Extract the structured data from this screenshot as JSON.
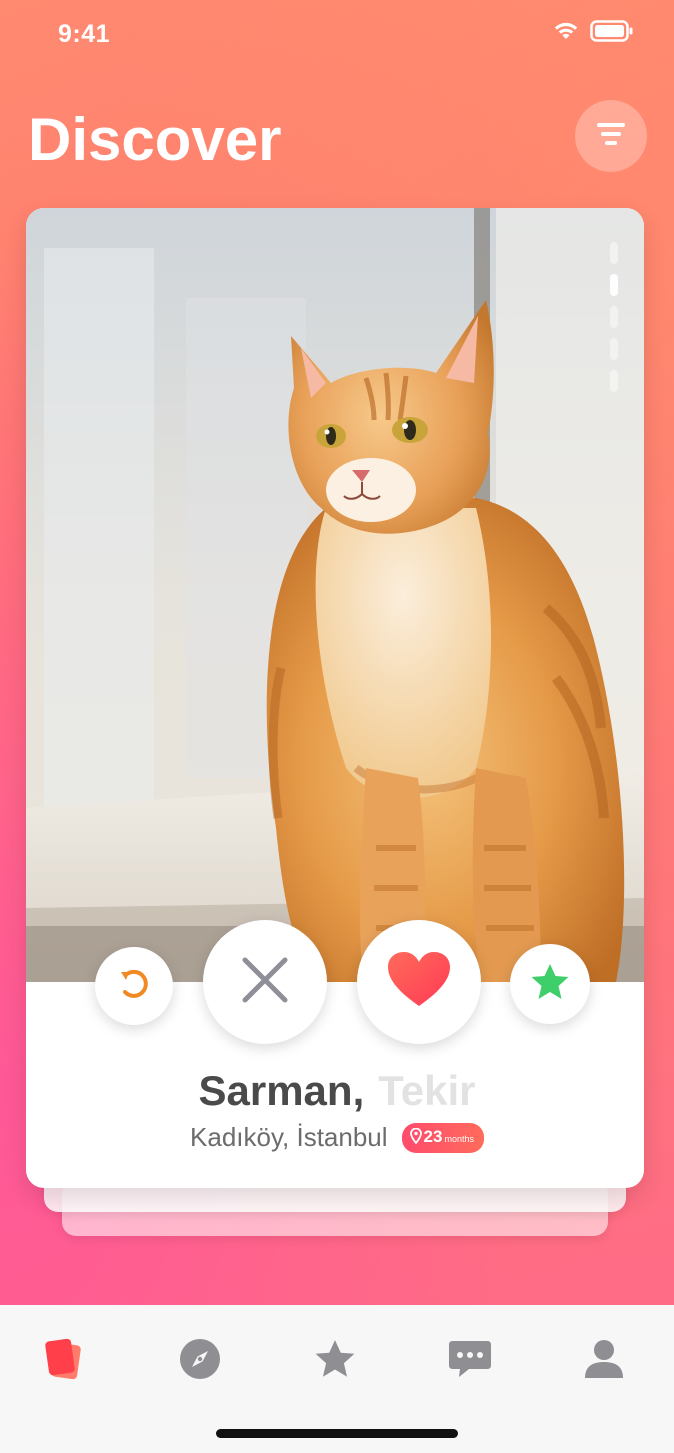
{
  "status_bar": {
    "time": "9:41",
    "icons": [
      "wifi-icon",
      "battery-icon"
    ]
  },
  "header": {
    "title": "Discover",
    "filter_icon": "filter-icon"
  },
  "card": {
    "name": "Sarman",
    "separator": ",",
    "breed": "Tekir",
    "location": "Kadıköy, İstanbul",
    "age_value": "23",
    "age_unit": "months",
    "photo_count": 5,
    "active_photo": 2
  },
  "actions": {
    "undo_icon": "undo-icon",
    "pass_icon": "close-icon",
    "like_icon": "heart-icon",
    "superlike_icon": "star-icon"
  },
  "tab_bar": {
    "items": [
      {
        "icon": "cards-icon",
        "active": true
      },
      {
        "icon": "compass-icon",
        "active": false
      },
      {
        "icon": "star-icon",
        "active": false
      },
      {
        "icon": "chat-icon",
        "active": false
      },
      {
        "icon": "profile-icon",
        "active": false
      }
    ]
  },
  "colors": {
    "accent": "#ff4b6e",
    "like": "#ff4b55",
    "superlike": "#3ecf6b",
    "undo": "#f08a24",
    "tab_active": "#ff4b4b",
    "tab_inactive": "#8e8e93"
  }
}
